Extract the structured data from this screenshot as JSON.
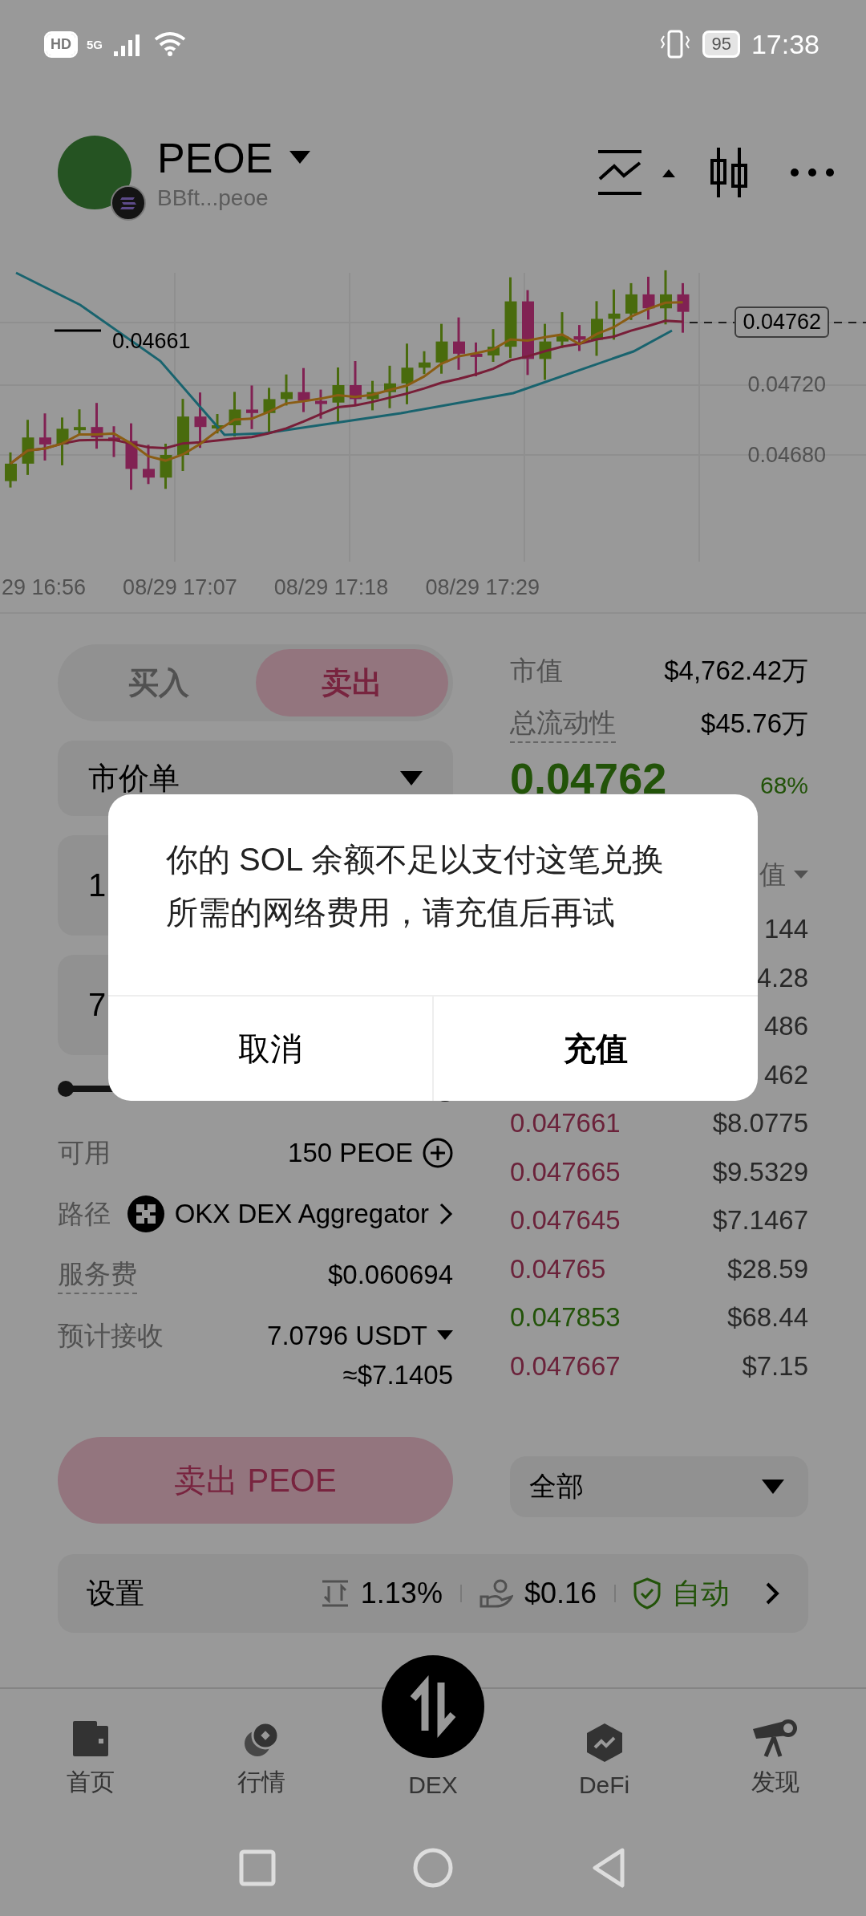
{
  "status_bar": {
    "hd": "HD",
    "network": "5G",
    "battery": "95",
    "time": "17:38"
  },
  "token": {
    "symbol": "PEOE",
    "address": "BBft...peoe"
  },
  "chart": {
    "price_tag": "0.04762",
    "y_labels": [
      "0.04720",
      "0.04680"
    ],
    "low_label": "0.04661",
    "x_labels": [
      "29 16:56",
      "08/29 17:07",
      "08/29 17:18",
      "08/29 17:29"
    ]
  },
  "trade_tabs": [
    {
      "label": "买入",
      "selected": false
    },
    {
      "label": "卖出",
      "selected": true
    }
  ],
  "order_type": "市价单",
  "amount_fields": [
    {
      "value": "1"
    },
    {
      "value": "7"
    }
  ],
  "slider": {
    "level": 1
  },
  "details": [
    {
      "label": "可用",
      "value": "150 PEOE",
      "kind": "add"
    },
    {
      "label": "路径",
      "value": "OKX DEX Aggregator",
      "kind": "route"
    },
    {
      "label": "服务费",
      "value": "$0.060694",
      "kind": "dotted"
    },
    {
      "label": "预计接收",
      "value": "7.0796 USDT",
      "kind": "dropdown",
      "sub": "≈$7.1405"
    }
  ],
  "sell_button": "卖出 PEOE",
  "stats": [
    {
      "label": "市值",
      "value": "$4,762.42万",
      "dotted": false
    },
    {
      "label": "总流动性",
      "value": "$45.76万",
      "dotted": true
    }
  ],
  "price": {
    "value": "0.04762",
    "change": "68%"
  },
  "order_header": "值",
  "order_partial": [
    "144",
    "4.28",
    "486",
    "462"
  ],
  "order_rows": [
    {
      "price": "0.047661",
      "value": "$8.0775",
      "kind": "sell"
    },
    {
      "price": "0.047665",
      "value": "$9.5329",
      "kind": "sell"
    },
    {
      "price": "0.047645",
      "value": "$7.1467",
      "kind": "sell"
    },
    {
      "price": "0.04765",
      "value": "$28.59",
      "kind": "sell"
    },
    {
      "price": "0.047853",
      "value": "$68.44",
      "kind": "buy"
    },
    {
      "price": "0.047667",
      "value": "$7.15",
      "kind": "sell"
    }
  ],
  "filter": "全部",
  "settings": {
    "label": "设置",
    "slippage": "1.13%",
    "fee": "$0.16",
    "mode": "自动"
  },
  "nav": [
    {
      "label": "首页",
      "kind": "wallet"
    },
    {
      "label": "行情",
      "kind": "market"
    },
    {
      "label": "DEX",
      "kind": "dex"
    },
    {
      "label": "DeFi",
      "kind": "defi"
    },
    {
      "label": "发现",
      "kind": "discover"
    }
  ],
  "dialog": {
    "message": "你的 SOL 余额不足以支付这笔兑换所需的网络费用，请充值后再试",
    "buttons": [
      {
        "label": "取消",
        "kind": "cancel"
      },
      {
        "label": "充值",
        "kind": "confirm"
      }
    ]
  }
}
